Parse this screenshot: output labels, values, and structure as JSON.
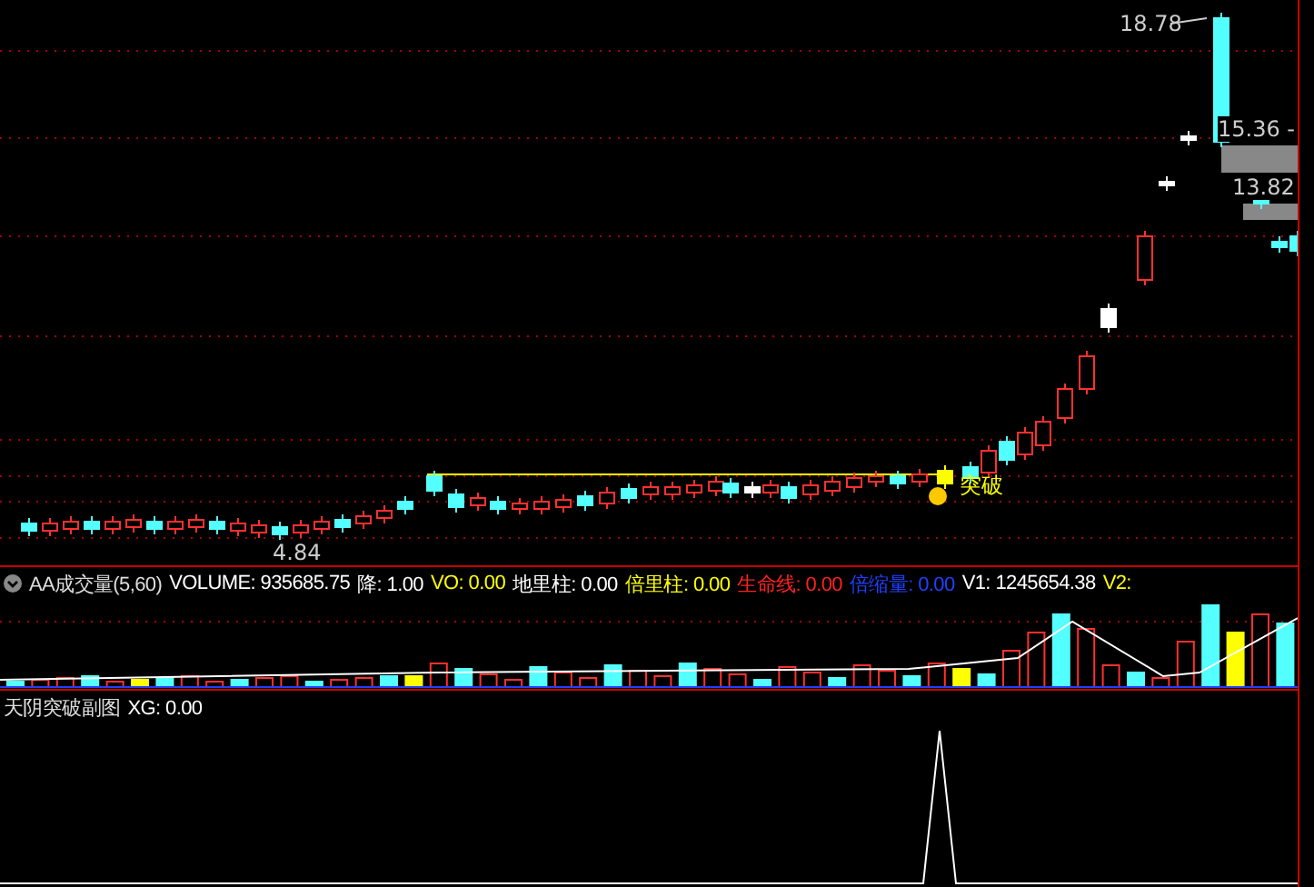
{
  "main_chart": {
    "high_label": "18.78",
    "mid_label": "15.36 -",
    "low_label": "13.82",
    "min_label": "4.84",
    "signal_label": "突破"
  },
  "volume_panel": {
    "title": "AA成交量(5,60)",
    "items": [
      {
        "text": "VOLUME: 935685.75",
        "color": "#ffffff"
      },
      {
        "text": "降: 1.00",
        "color": "#ffffff"
      },
      {
        "text": "VO: 0.00",
        "color": "#ffff00"
      },
      {
        "text": "地里柱: 0.00",
        "color": "#ffffff"
      },
      {
        "text": "倍里柱: 0.00",
        "color": "#ffff00"
      },
      {
        "text": "生命线: 0.00",
        "color": "#ff2020"
      },
      {
        "text": "倍缩量: 0.00",
        "color": "#2040ff"
      },
      {
        "text": "V1: 1245654.38",
        "color": "#ffffff"
      },
      {
        "text": "V2:",
        "color": "#ffff00"
      }
    ]
  },
  "signal_panel": {
    "title": "天阴突破副图",
    "items": [
      {
        "text": "XG: 0.00",
        "color": "#ffffff"
      }
    ]
  }
}
